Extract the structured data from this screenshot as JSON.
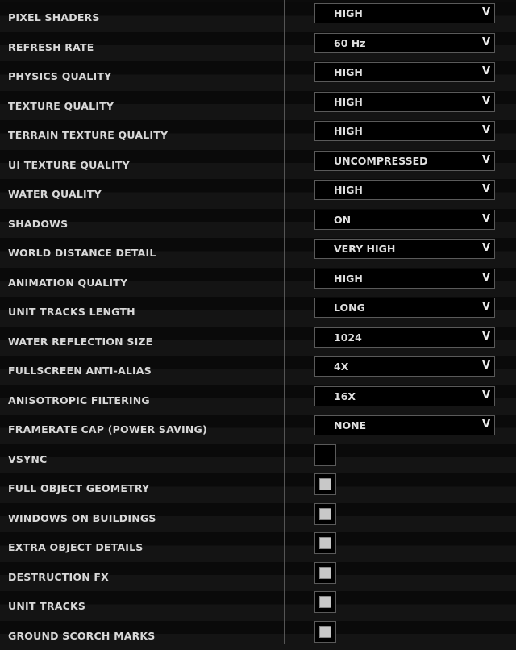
{
  "dropdowns": [
    {
      "label": "PIXEL SHADERS",
      "value": "HIGH"
    },
    {
      "label": "REFRESH RATE",
      "value": "60 Hz"
    },
    {
      "label": "PHYSICS QUALITY",
      "value": "HIGH"
    },
    {
      "label": "TEXTURE QUALITY",
      "value": "HIGH"
    },
    {
      "label": "TERRAIN TEXTURE QUALITY",
      "value": "HIGH"
    },
    {
      "label": "UI TEXTURE QUALITY",
      "value": "UNCOMPRESSED"
    },
    {
      "label": "WATER QUALITY",
      "value": "HIGH"
    },
    {
      "label": "SHADOWS",
      "value": "ON"
    },
    {
      "label": "WORLD DISTANCE DETAIL",
      "value": "VERY HIGH"
    },
    {
      "label": "ANIMATION QUALITY",
      "value": "HIGH"
    },
    {
      "label": "UNIT TRACKS LENGTH",
      "value": "LONG"
    },
    {
      "label": "WATER REFLECTION SIZE",
      "value": "1024"
    },
    {
      "label": "FULLSCREEN ANTI-ALIAS",
      "value": "4X"
    },
    {
      "label": "ANISOTROPIC FILTERING",
      "value": "16X"
    },
    {
      "label": "FRAMERATE CAP (POWER SAVING)",
      "value": "NONE"
    }
  ],
  "checkboxes": [
    {
      "label": "VSYNC",
      "checked": false
    },
    {
      "label": "FULL OBJECT GEOMETRY",
      "checked": true
    },
    {
      "label": "WINDOWS ON BUILDINGS",
      "checked": true
    },
    {
      "label": "EXTRA OBJECT DETAILS",
      "checked": true
    },
    {
      "label": "DESTRUCTION FX",
      "checked": true
    },
    {
      "label": "UNIT TRACKS",
      "checked": true
    },
    {
      "label": "GROUND SCORCH MARKS",
      "checked": true
    }
  ],
  "icons": {
    "dropdown": "chevron-down-icon",
    "checkbox": "checkbox-icon"
  }
}
